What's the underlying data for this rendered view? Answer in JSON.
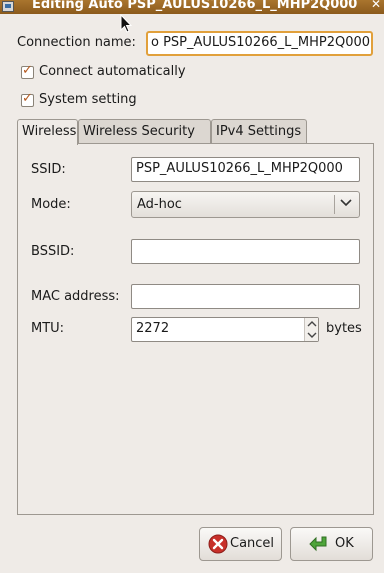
{
  "window": {
    "title": "Editing Auto PSP_AULUS10266_L_MHP2Q000",
    "close_glyph": "✕"
  },
  "connection": {
    "label": "Connection name:",
    "value": "o PSP_AULUS10266_L_MHP2Q000",
    "focus_color": "#e1a03b"
  },
  "options": {
    "connect_automatically": {
      "label": "Connect automatically",
      "checked": true
    },
    "system_setting": {
      "label": "System setting",
      "checked": true
    }
  },
  "tabs": [
    {
      "label": "Wireless",
      "active": true
    },
    {
      "label": "Wireless Security",
      "active": false
    },
    {
      "label": "IPv4 Settings",
      "active": false
    }
  ],
  "wireless": {
    "ssid": {
      "label": "SSID:",
      "value": "PSP_AULUS10266_L_MHP2Q000"
    },
    "mode": {
      "label": "Mode:",
      "value": "Ad-hoc"
    },
    "bssid": {
      "label": "BSSID:",
      "value": ""
    },
    "mac": {
      "label": "MAC address:",
      "value": ""
    },
    "mtu": {
      "label": "MTU:",
      "value": "2272",
      "unit": "bytes"
    }
  },
  "buttons": {
    "cancel": {
      "label": "Cancel",
      "icon": "cancel-icon",
      "color": "#c8302a"
    },
    "ok": {
      "label": "OK",
      "icon": "ok-arrow-icon",
      "color": "#4ea53a"
    }
  },
  "titlebar_color": "#9a6826"
}
